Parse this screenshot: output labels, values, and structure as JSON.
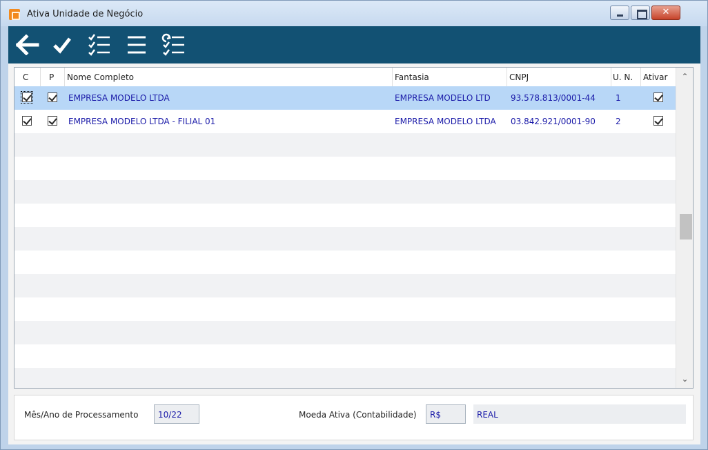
{
  "window": {
    "title": "Ativa Unidade de Negócio"
  },
  "toolbar": {
    "buttons": [
      {
        "name": "back",
        "icon": "arrow-left-icon"
      },
      {
        "name": "confirm",
        "icon": "check-icon"
      },
      {
        "name": "check-all",
        "icon": "checklist-icon"
      },
      {
        "name": "list",
        "icon": "list-icon"
      },
      {
        "name": "invert-selection",
        "icon": "refresh-checklist-icon"
      }
    ]
  },
  "grid": {
    "columns": {
      "c": "C",
      "p": "P",
      "nome": "Nome Completo",
      "fantasia": "Fantasia",
      "cnpj": "CNPJ",
      "un": "U. N.",
      "ativar": "Ativar"
    },
    "rows": [
      {
        "c": true,
        "p": true,
        "nome": "EMPRESA MODELO LTDA",
        "fantasia": "EMPRESA MODELO LTD",
        "cnpj": "93.578.813/0001-44",
        "un": "1",
        "ativar": true,
        "selected": true
      },
      {
        "c": true,
        "p": true,
        "nome": "EMPRESA MODELO LTDA - FILIAL 01",
        "fantasia": "EMPRESA MODELO LTDA",
        "cnpj": "03.842.921/0001-90",
        "un": "2",
        "ativar": true,
        "selected": false
      }
    ]
  },
  "footer": {
    "mes_ano_label": "Mês/Ano de Processamento",
    "mes_ano_value": "10/22",
    "moeda_label": "Moeda Ativa (Contabilidade)",
    "moeda_code": "R$",
    "moeda_name": "REAL"
  },
  "colors": {
    "toolbar": "#125173",
    "selected_row": "#b8d7f7",
    "row_text": "#1a1aa8",
    "stripe": "#f1f2f4"
  }
}
